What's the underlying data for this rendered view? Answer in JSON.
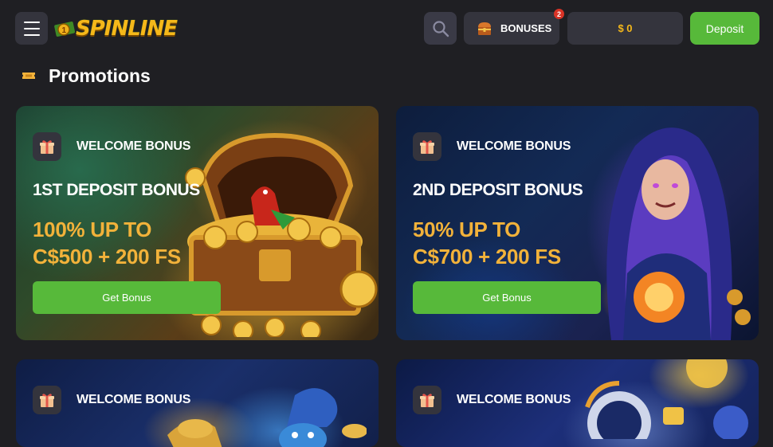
{
  "header": {
    "logo_text": "SPINLINE",
    "bonuses_label": "BONUSES",
    "bonuses_badge": "2",
    "balance": "$ 0",
    "deposit_label": "Deposit"
  },
  "page": {
    "title": "Promotions"
  },
  "colors": {
    "accent_green": "#57b93a",
    "offer_gold": "#f2b23a",
    "background": "#1f1f23",
    "button_dark": "#34343d",
    "badge_red": "#d93326"
  },
  "icons": {
    "menu": "hamburger-icon",
    "search": "search-icon",
    "bonuses": "treasure-chest-icon",
    "title": "ticket-icon",
    "card": "gift-icon"
  },
  "promotions": [
    {
      "label": "WELCOME BONUS",
      "name": "1ST DEPOSIT BONUS",
      "offer_line1": "100% UP TO",
      "offer_line2": "C$500 + 200 FS",
      "button": "Get Bonus"
    },
    {
      "label": "WELCOME BONUS",
      "name": "2ND DEPOSIT BONUS",
      "offer_line1": "50% UP TO",
      "offer_line2": "C$700 + 200 FS",
      "button": "Get Bonus"
    },
    {
      "label": "WELCOME BONUS"
    },
    {
      "label": "WELCOME BONUS"
    }
  ]
}
